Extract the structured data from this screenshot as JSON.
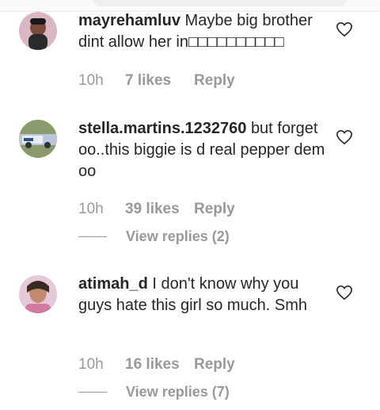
{
  "comments": [
    {
      "username": "mayrehamluv",
      "text": "Maybe big brother dint allow her in□□□□□□□□□□",
      "time": "10h",
      "likes": "7 likes",
      "reply": "Reply",
      "view_replies": ""
    },
    {
      "username": "stella.martins.1232760",
      "text": "but forget oo..this biggie is d real pepper dem oo",
      "time": "10h",
      "likes": "39 likes",
      "reply": "Reply",
      "view_replies": "View replies (2)"
    },
    {
      "username": "atimah_d",
      "text": "I don't know why you guys hate this girl so much. Smh",
      "time": "10h",
      "likes": "16 likes",
      "reply": "Reply",
      "view_replies": "View replies (7)"
    }
  ],
  "icons": {
    "like": "heart-outline-icon"
  },
  "colors": {
    "text": "#262626",
    "secondary": "#999999"
  }
}
